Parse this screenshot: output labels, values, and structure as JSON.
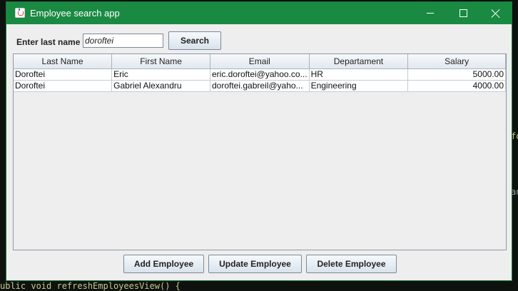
{
  "window": {
    "title": "Employee search app"
  },
  "search": {
    "label": "Enter last name",
    "value": "doroftei",
    "button_label": "Search"
  },
  "table": {
    "columns": [
      "Last Name",
      "First Name",
      "Email",
      "Departament",
      "Salary"
    ],
    "rows": [
      [
        "Doroftei",
        "Eric",
        "eric.doroftei@yahoo.co...",
        "HR",
        "5000.00"
      ],
      [
        "Doroftei",
        "Gabriel Alexandru",
        "doroftei.gabreil@yaho...",
        "Engineering",
        "4000.00"
      ]
    ]
  },
  "actions": {
    "add_label": "Add Employee",
    "update_label": "Update Employee",
    "delete_label": "Delete Employee"
  },
  "background": {
    "code_line": "ublic void refreshEmployeesView() {",
    "right_fragment_1": "fo",
    "right_fragment_2": "an"
  }
}
